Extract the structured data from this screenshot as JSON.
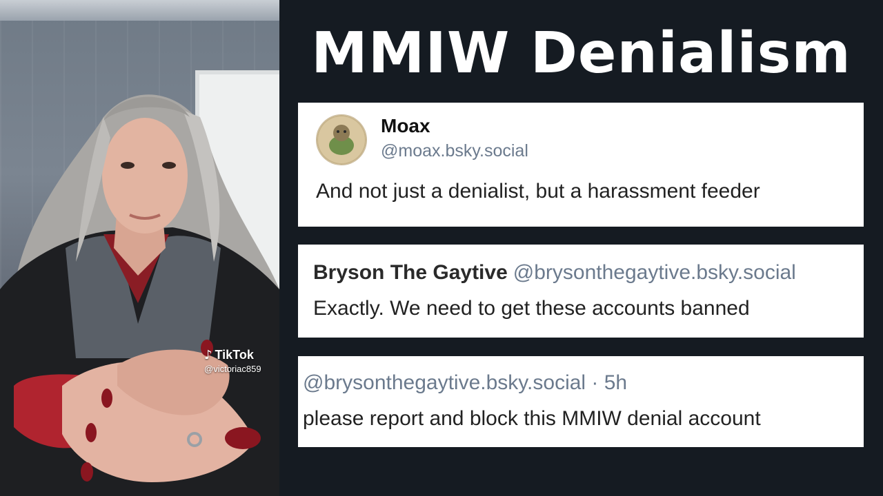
{
  "title": "MMIW Denialism",
  "video": {
    "watermark_brand": "TikTok",
    "watermark_handle": "@victoriac859",
    "logo_icon": "tiktok-note-icon"
  },
  "posts": [
    {
      "name": "Moax",
      "handle": "@moax.bsky.social",
      "text": "And not just a denialist, but a harassment feeder",
      "avatar_icon": "avatar-image"
    },
    {
      "name": "Bryson The Gaytive",
      "handle": "@brysonthegaytive.bsky.social",
      "text": "Exactly. We need to get these accounts banned"
    },
    {
      "meta": "@brysonthegaytive.bsky.social · 5h",
      "text": "please report and block this MMIW denial account"
    }
  ],
  "colors": {
    "background": "#151b22",
    "card": "#ffffff",
    "handle": "#6b7a8d"
  }
}
